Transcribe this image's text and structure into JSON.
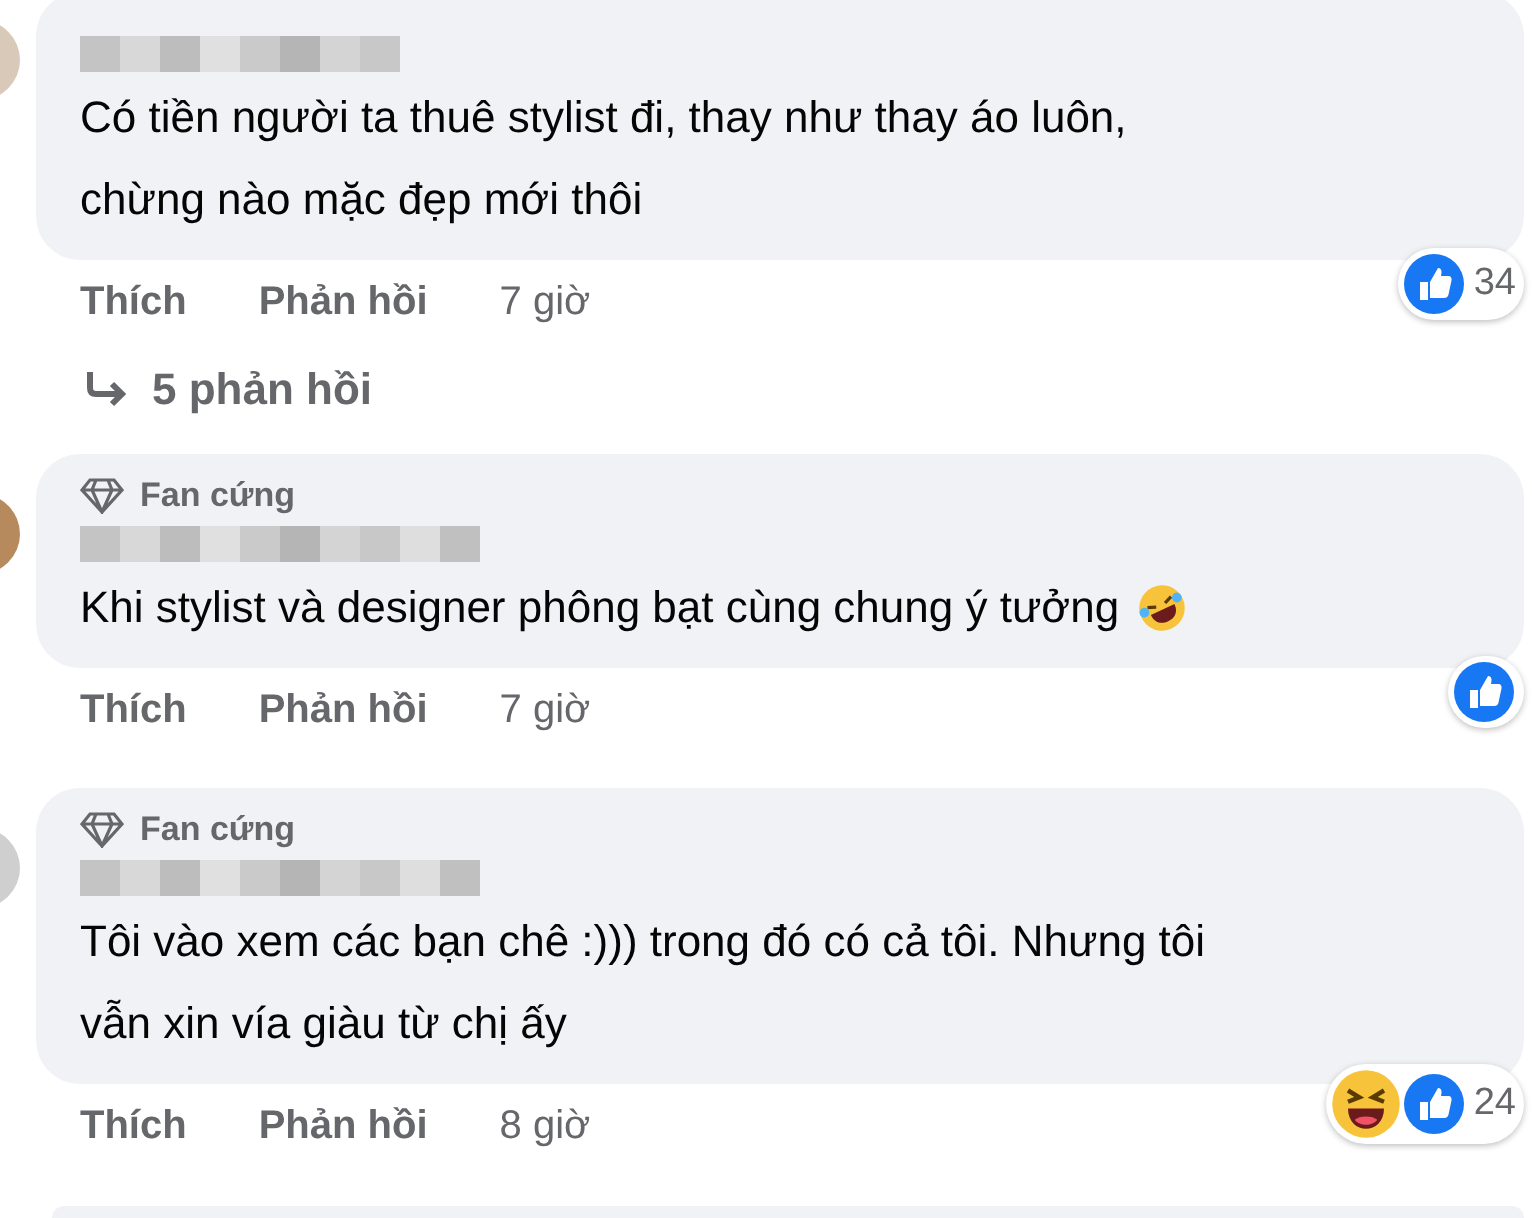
{
  "comments": [
    {
      "lines": [
        "Có tiền người ta thuê stylist đi, thay như thay áo luôn,",
        "chừng nào mặc đẹp mới thôi"
      ],
      "reactions": [
        {
          "kind": "like"
        }
      ],
      "reaction_count": "34",
      "actions": [
        "Thích",
        "Phản hồi",
        "7 giờ"
      ],
      "replies": "5 phản hồi"
    },
    {
      "badge": "Fan cứng",
      "lines": [
        "Khi stylist và designer phông bạt cùng chung ý tưởng"
      ],
      "trailing_emoji": true,
      "reactions": [
        {
          "kind": "like"
        }
      ],
      "actions": [
        "Thích",
        "Phản hồi",
        "7 giờ"
      ]
    },
    {
      "badge": "Fan cứng",
      "lines": [
        "Tôi vào xem các bạn chê :))) trong đó có cả tôi. Nhưng tôi",
        "vẫn xin vía giàu từ chị ấy"
      ],
      "reactions": [
        {
          "kind": "haha"
        },
        {
          "kind": "like"
        }
      ],
      "reaction_count": "24",
      "actions": [
        "Thích",
        "Phản hồi",
        "8 giờ"
      ]
    }
  ]
}
